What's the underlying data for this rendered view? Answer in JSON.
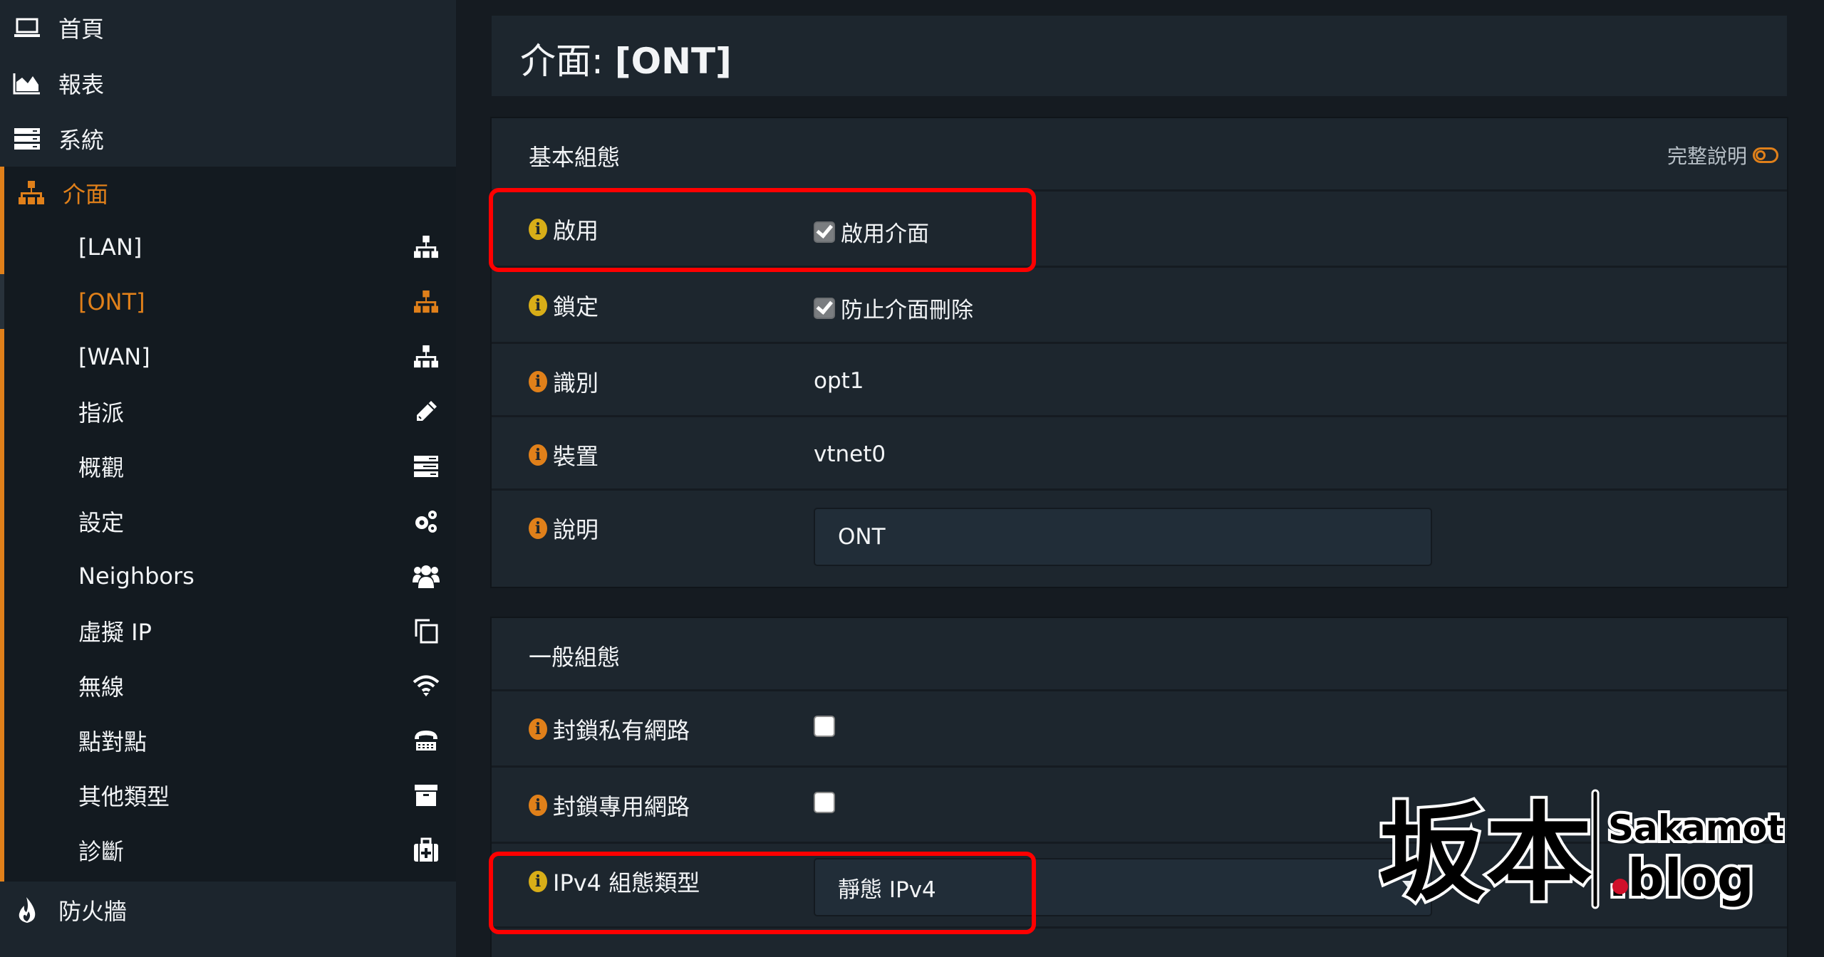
{
  "sidebar": {
    "top_items": [
      {
        "label": "首頁",
        "icon": "laptop-icon"
      },
      {
        "label": "報表",
        "icon": "area-chart-icon"
      },
      {
        "label": "系統",
        "icon": "server-icon"
      },
      {
        "label": "介面",
        "icon": "sitemap-icon",
        "active": true
      }
    ],
    "sub_items": [
      {
        "label": "[LAN]",
        "icon": "sitemap-icon"
      },
      {
        "label": "[ONT]",
        "icon": "sitemap-icon",
        "active": true
      },
      {
        "label": "[WAN]",
        "icon": "sitemap-icon"
      },
      {
        "label": "指派",
        "icon": "pencil-icon"
      },
      {
        "label": "概觀",
        "icon": "tasks-icon"
      },
      {
        "label": "設定",
        "icon": "cogs-icon"
      },
      {
        "label": "Neighbors",
        "icon": "users-icon"
      },
      {
        "label": "虛擬 IP",
        "icon": "clone-icon"
      },
      {
        "label": "無線",
        "icon": "wifi-icon"
      },
      {
        "label": "點對點",
        "icon": "phone-icon"
      },
      {
        "label": "其他類型",
        "icon": "archive-icon"
      },
      {
        "label": "診斷",
        "icon": "medkit-icon"
      }
    ],
    "bottom_items": [
      {
        "label": "防火牆",
        "icon": "fire-icon"
      }
    ]
  },
  "page": {
    "title_prefix": "介面: ",
    "title_name": "[ONT]"
  },
  "basic_config": {
    "title": "基本組態",
    "help_label": "完整說明",
    "help_enabled": false,
    "rows": {
      "enable": {
        "label": "啟用",
        "checkbox_label": "啟用介面",
        "checked": true
      },
      "lock": {
        "label": "鎖定",
        "checkbox_label": "防止介面刪除",
        "checked": true
      },
      "identifier": {
        "label": "識別",
        "value": "opt1"
      },
      "device": {
        "label": "裝置",
        "value": "vtnet0"
      },
      "description": {
        "label": "說明",
        "value": "ONT"
      }
    }
  },
  "general_config": {
    "title": "一般組態",
    "rows": {
      "block_private": {
        "label": "封鎖私有網路",
        "checked": false
      },
      "block_bogon": {
        "label": "封鎖專用網路",
        "checked": false
      },
      "ipv4_type": {
        "label": "IPv4 組態類型",
        "selected": "靜態 IPv4"
      }
    }
  },
  "watermark": {
    "kanji": "坂本",
    "name": "Sakamoto",
    "domain": ".blog"
  },
  "colors": {
    "accent": "#e0801a",
    "highlight": "#ff0000",
    "panel_bg": "#1d262e",
    "page_bg": "#151b21"
  }
}
